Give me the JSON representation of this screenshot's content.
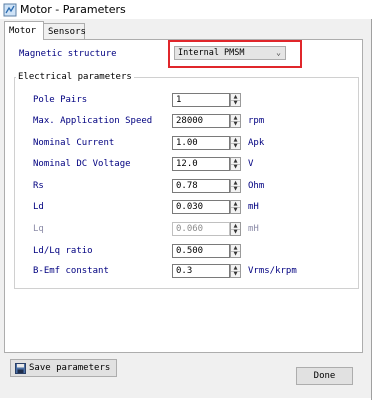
{
  "window": {
    "title": "Motor - Parameters"
  },
  "tabs": [
    {
      "label": "Motor"
    },
    {
      "label": "Sensors"
    }
  ],
  "magnetic": {
    "label": "Magnetic structure",
    "value": "Internal PMSM"
  },
  "electrical": {
    "group_title": "Electrical parameters",
    "rows": [
      {
        "label": "Pole Pairs",
        "value": "1",
        "unit": ""
      },
      {
        "label": "Max. Application Speed",
        "value": "28000",
        "unit": "rpm"
      },
      {
        "label": "Nominal Current",
        "value": "1.00",
        "unit": "Apk"
      },
      {
        "label": "Nominal DC Voltage",
        "value": "12.0",
        "unit": "V"
      },
      {
        "label": "Rs",
        "value": "0.78",
        "unit": "Ohm"
      },
      {
        "label": "Ld",
        "value": "0.030",
        "unit": "mH"
      },
      {
        "label": "Lq",
        "value": "0.060",
        "unit": "mH"
      },
      {
        "label": "Ld/Lq ratio",
        "value": "0.500",
        "unit": ""
      },
      {
        "label": "B-Emf constant",
        "value": "0.3",
        "unit": "Vrms/krpm"
      }
    ]
  },
  "buttons": {
    "save": "Save parameters",
    "done": "Done"
  }
}
